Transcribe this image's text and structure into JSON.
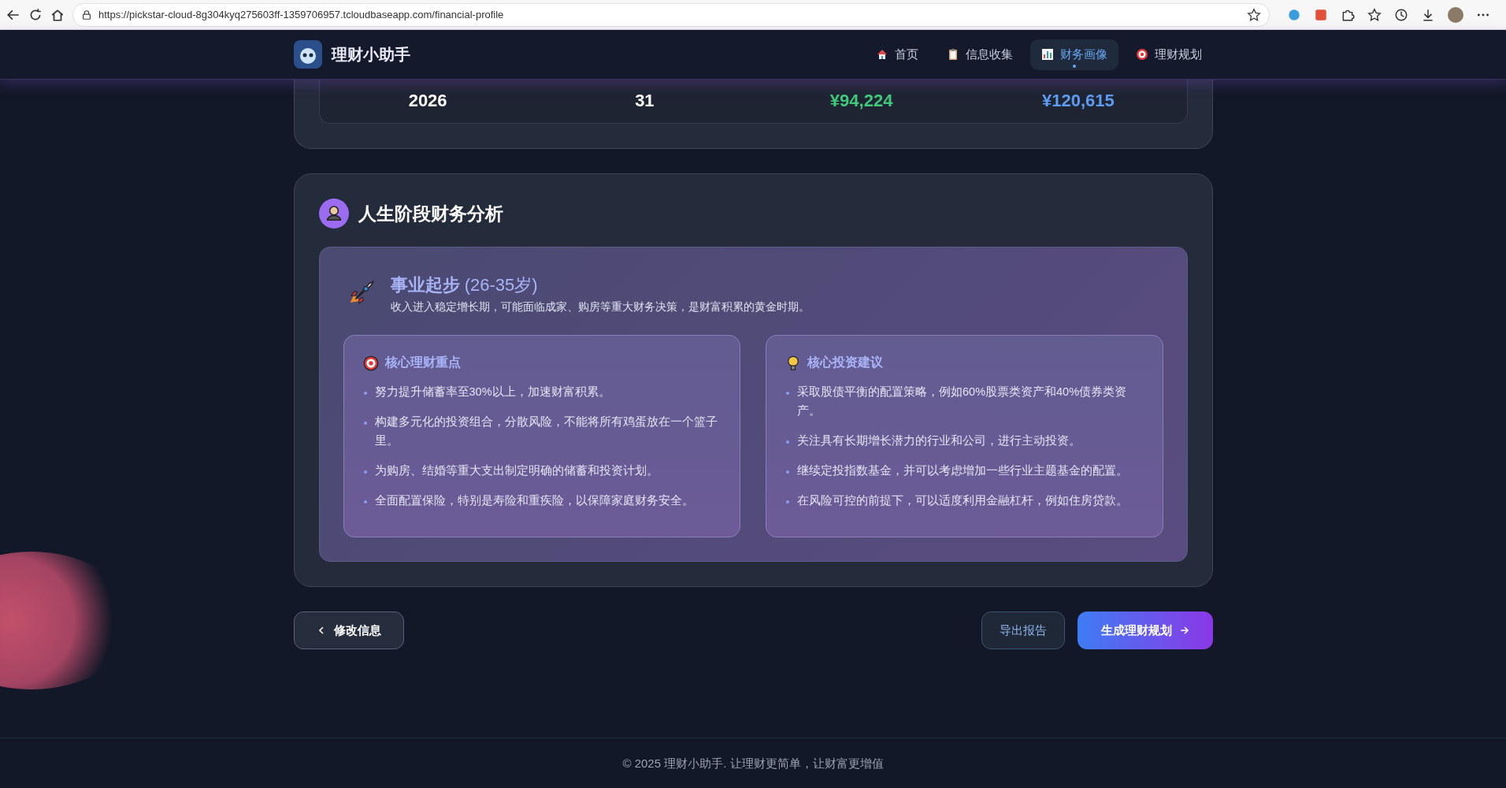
{
  "browser": {
    "url": "https://pickstar-cloud-8g304kyq275603ff-1359706957.tcloudbaseapp.com/financial-profile"
  },
  "header": {
    "brand": "理财小助手",
    "nav": [
      {
        "label": "首页",
        "selected": false
      },
      {
        "label": "信息收集",
        "selected": false
      },
      {
        "label": "财务画像",
        "selected": true
      },
      {
        "label": "理财规划",
        "selected": false
      }
    ]
  },
  "summary_row": [
    {
      "text": "2026",
      "color": "#ffffff"
    },
    {
      "text": "31",
      "color": "#ffffff"
    },
    {
      "text": "¥94,224",
      "color": "#3fc97a"
    },
    {
      "text": "¥120,615",
      "color": "#5d9cf0"
    }
  ],
  "life_stage": {
    "title": "人生阶段财务分析",
    "stage_name": "事业起步",
    "stage_age": "(26-35岁)",
    "stage_description": "收入进入稳定增长期，可能面临成家、购房等重大财务决策，是财富积累的黄金时期。",
    "panels": [
      {
        "title": "核心理财重点",
        "items": [
          "努力提升储蓄率至30%以上，加速财富积累。",
          "构建多元化的投资组合，分散风险，不能将所有鸡蛋放在一个篮子里。",
          "为购房、结婚等重大支出制定明确的储蓄和投资计划。",
          "全面配置保险，特别是寿险和重疾险，以保障家庭财务安全。"
        ]
      },
      {
        "title": "核心投资建议",
        "items": [
          "采取股债平衡的配置策略，例如60%股票类资产和40%债券类资产。",
          "关注具有长期增长潜力的行业和公司，进行主动投资。",
          "继续定投指数基金，并可以考虑增加一些行业主题基金的配置。",
          "在风险可控的前提下，可以适度利用金融杠杆，例如住房贷款。"
        ]
      }
    ]
  },
  "actions": {
    "back": "修改信息",
    "export": "导出报告",
    "generate": "生成理财规划"
  },
  "footer": "© 2025 理财小助手. 让理财更简单，让财富更增值"
}
